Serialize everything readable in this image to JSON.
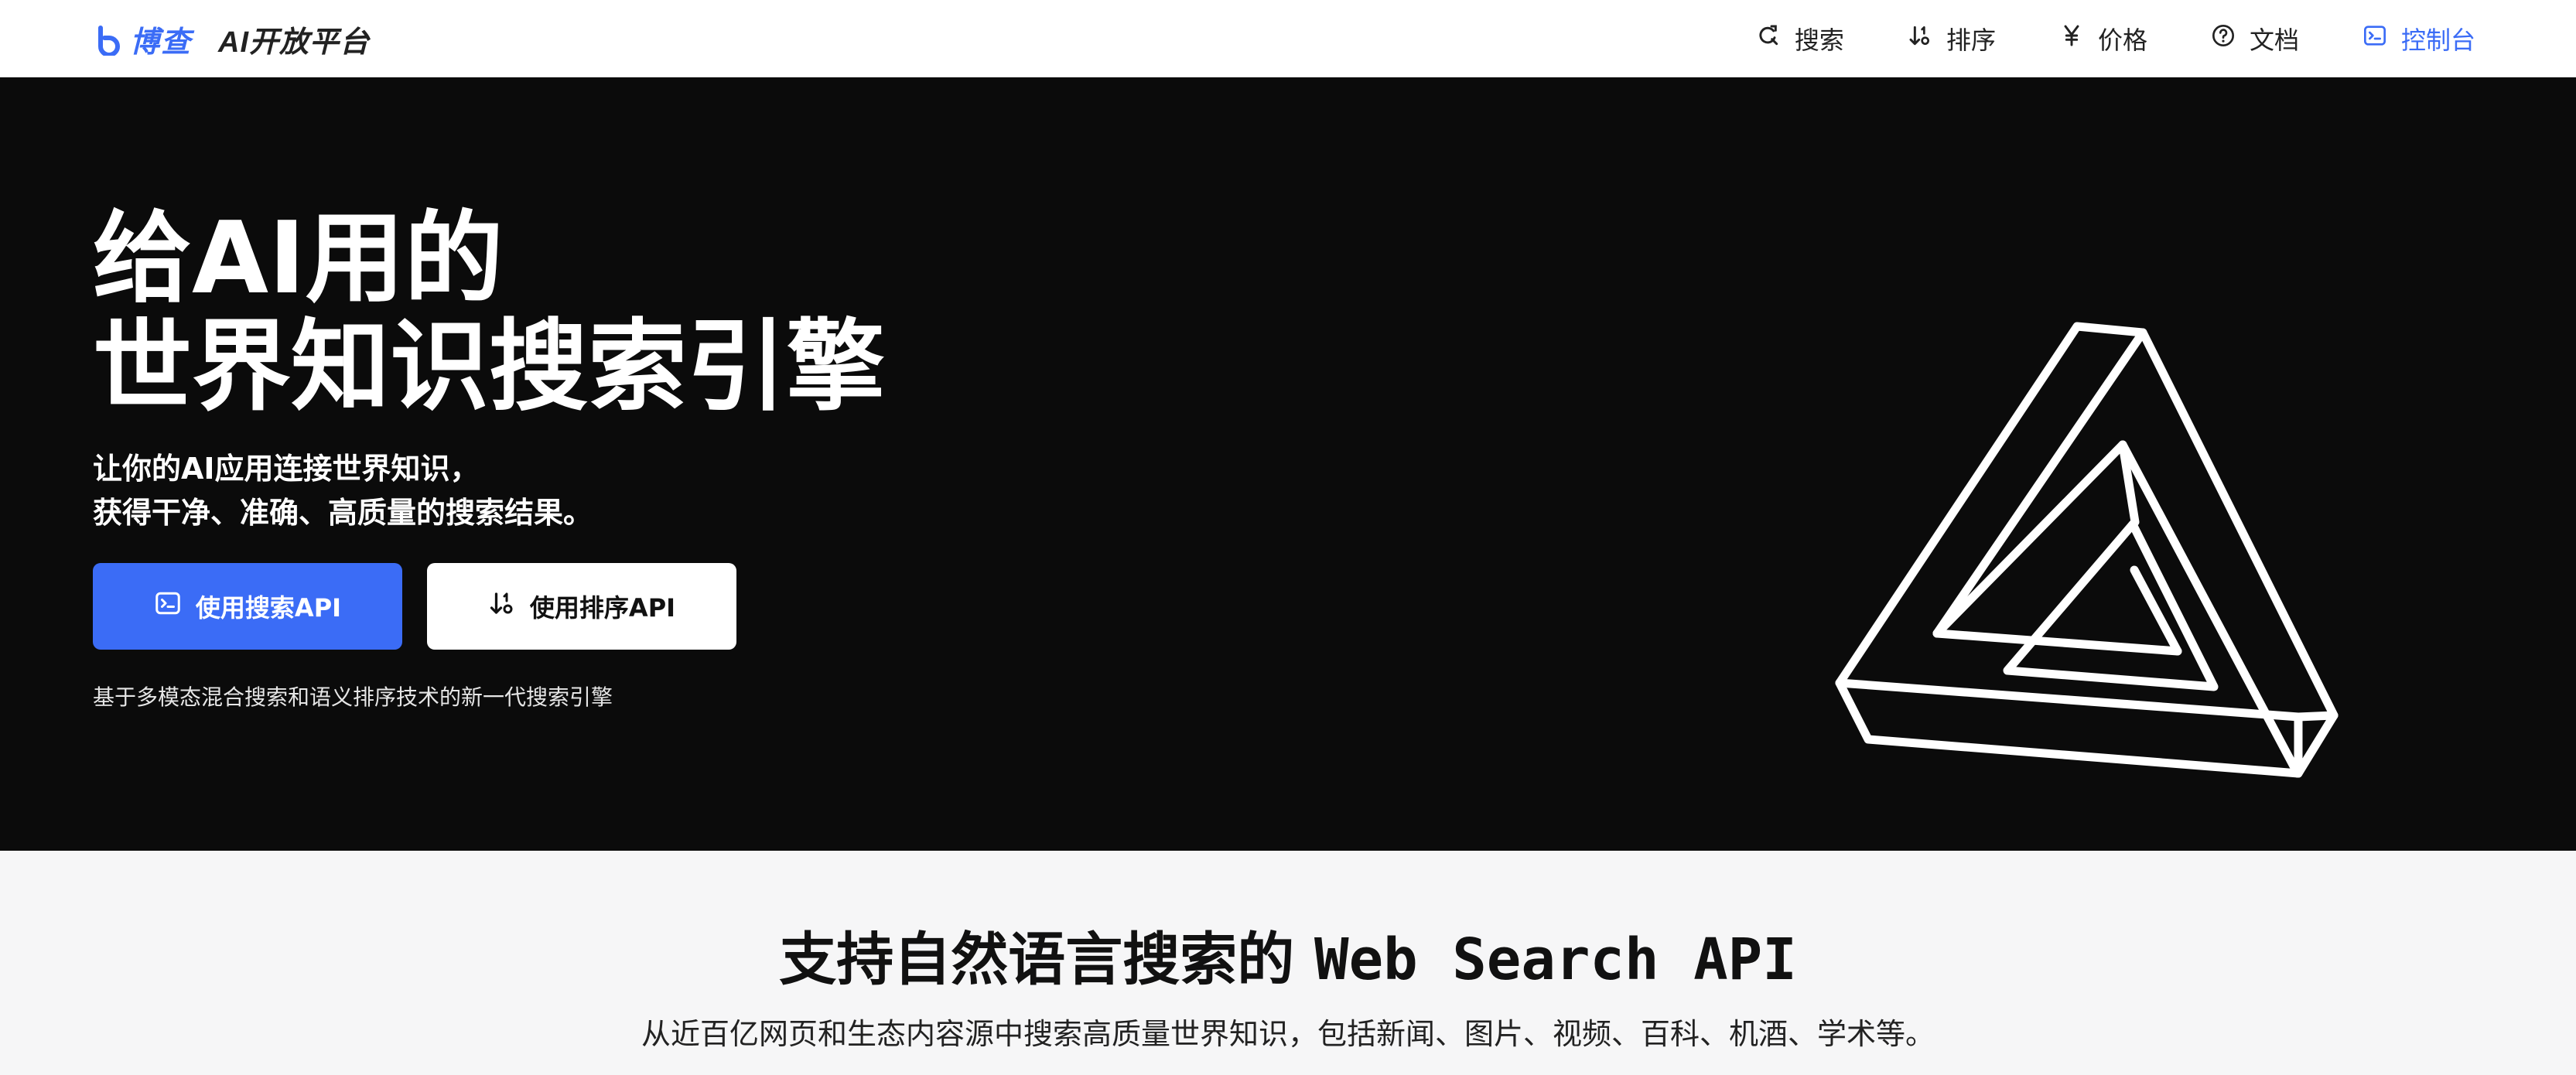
{
  "header": {
    "brand": {
      "name": "博查",
      "subtitle": "AI开放平台",
      "logo_icon": "bocha-logo-icon",
      "accent": "#3b6cf6"
    },
    "nav": [
      {
        "label": "搜索",
        "icon": "search-icon"
      },
      {
        "label": "排序",
        "icon": "sort-icon"
      },
      {
        "label": "价格",
        "icon": "yen-icon"
      },
      {
        "label": "文档",
        "icon": "help-circle-icon"
      },
      {
        "label": "控制台",
        "icon": "terminal-icon",
        "active": true
      }
    ]
  },
  "hero": {
    "title_line1": "给AI用的",
    "title_line2": "世界知识搜索引擎",
    "subtitle_line1": "让你的AI应用连接世界知识，",
    "subtitle_line2": "获得干净、准确、高质量的搜索结果。",
    "primary_button": "使用搜索API",
    "secondary_button": "使用排序API",
    "note": "基于多模态混合搜索和语义排序技术的新一代搜索引擎",
    "art": "impossible-triangle-icon",
    "background": "#0b0b0b"
  },
  "features": {
    "title_zh": "支持自然语言搜索的 ",
    "title_en": "Web Search API",
    "description": "从近百亿网页和生态内容源中搜索高质量世界知识，包括新闻、图片、视频、百科、机酒、学术等。"
  }
}
